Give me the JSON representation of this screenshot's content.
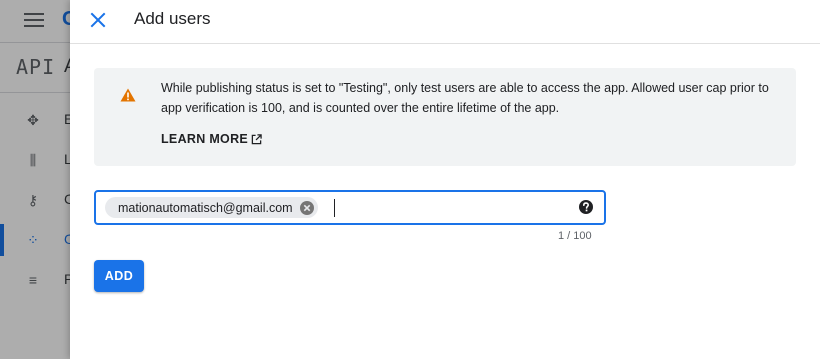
{
  "background": {
    "logo_letter": "G",
    "api_label": "API",
    "page_title": "A",
    "nav": [
      {
        "icon": "apis-services-icon",
        "label": "E"
      },
      {
        "icon": "library-icon",
        "label": "L"
      },
      {
        "icon": "key-icon",
        "label": "C"
      },
      {
        "icon": "consent-screen-icon",
        "label": "O",
        "active": true
      },
      {
        "icon": "page-settings-icon",
        "label": "P"
      }
    ]
  },
  "dialog": {
    "title": "Add users",
    "close_icon": "close-icon",
    "notice": {
      "icon": "warning-icon",
      "text": "While publishing status is set to \"Testing\", only test users are able to access the app. Allowed user cap prior to app verification is 100, and is counted over the entire lifetime of the app.",
      "learn_more_label": "LEARN MORE",
      "learn_more_icon": "open-in-new-icon"
    },
    "user_field": {
      "chips": [
        "mationautomatisch@gmail.com"
      ],
      "chip_remove_icon": "cancel-icon",
      "value": "",
      "help_icon": "help-icon",
      "counter": "1 / 100"
    },
    "add_label": "ADD"
  },
  "colors": {
    "accent": "#1a73e8",
    "warning": "#e37400",
    "notice_bg": "#f1f3f4"
  }
}
